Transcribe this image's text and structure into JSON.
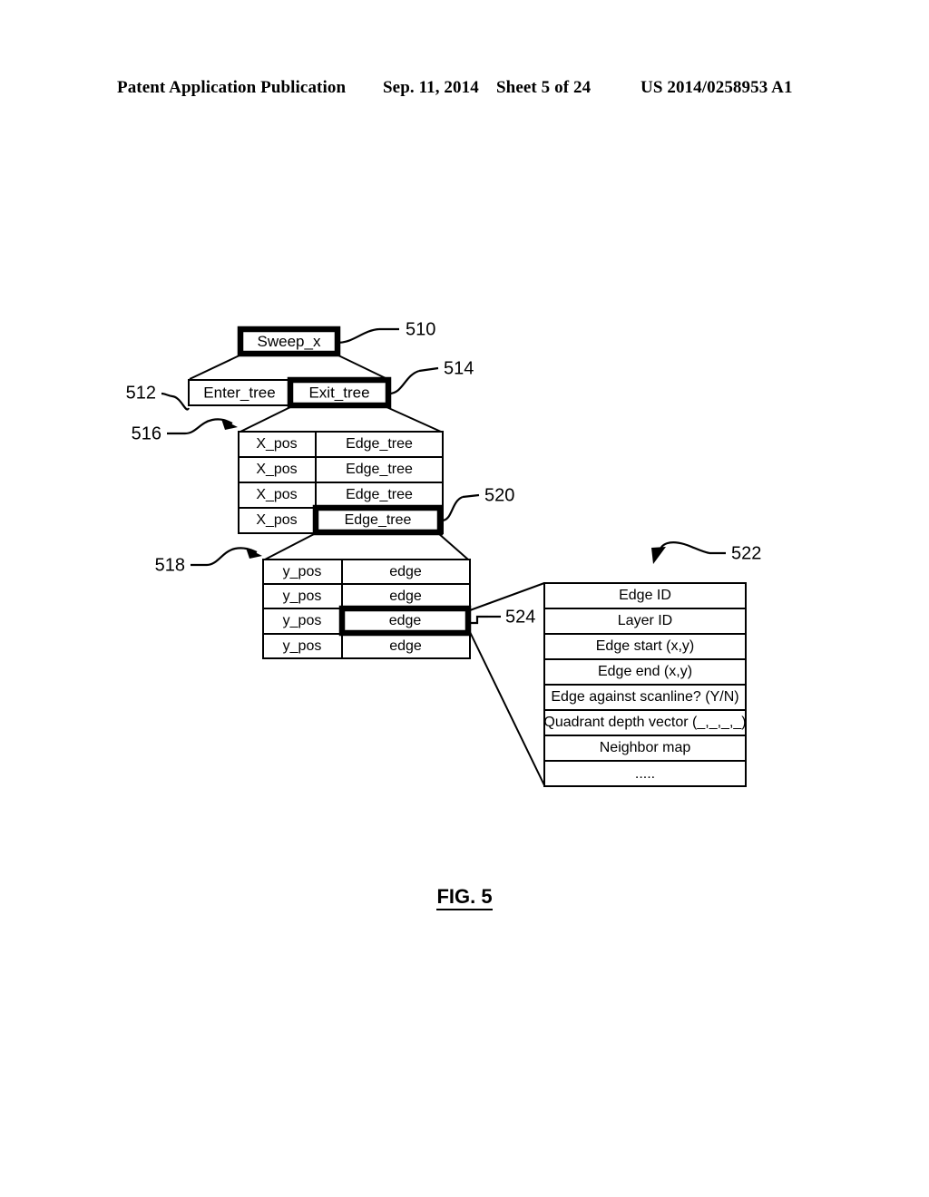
{
  "header": {
    "publication": "Patent Application Publication",
    "date": "Sep. 11, 2014",
    "sheet": "Sheet 5 of 24",
    "doc_number": "US 2014/0258953 A1"
  },
  "figure": {
    "caption": "FIG. 5",
    "root_box": {
      "label": "Sweep_x",
      "ref": "510"
    },
    "tree_row": {
      "enter": {
        "label": "Enter_tree",
        "ref": "512"
      },
      "exit": {
        "label": "Exit_tree",
        "ref": "514"
      }
    },
    "x_table": {
      "ref": "516",
      "highlight_ref": "520",
      "rows": [
        {
          "key": "X_pos",
          "value": "Edge_tree"
        },
        {
          "key": "X_pos",
          "value": "Edge_tree"
        },
        {
          "key": "X_pos",
          "value": "Edge_tree"
        },
        {
          "key": "X_pos",
          "value": "Edge_tree"
        }
      ]
    },
    "y_table": {
      "ref": "518",
      "highlight_ref": "524",
      "rows": [
        {
          "key": "y_pos",
          "value": "edge"
        },
        {
          "key": "y_pos",
          "value": "edge"
        },
        {
          "key": "y_pos",
          "value": "edge"
        },
        {
          "key": "y_pos",
          "value": "edge"
        }
      ]
    },
    "edge_record": {
      "ref": "522",
      "fields": [
        "Edge ID",
        "Layer ID",
        "Edge start (x,y)",
        "Edge end (x,y)",
        "Edge against scanline? (Y/N)",
        "Quadrant depth vector (_,_,_,_)",
        "Neighbor map",
        "....."
      ]
    }
  }
}
